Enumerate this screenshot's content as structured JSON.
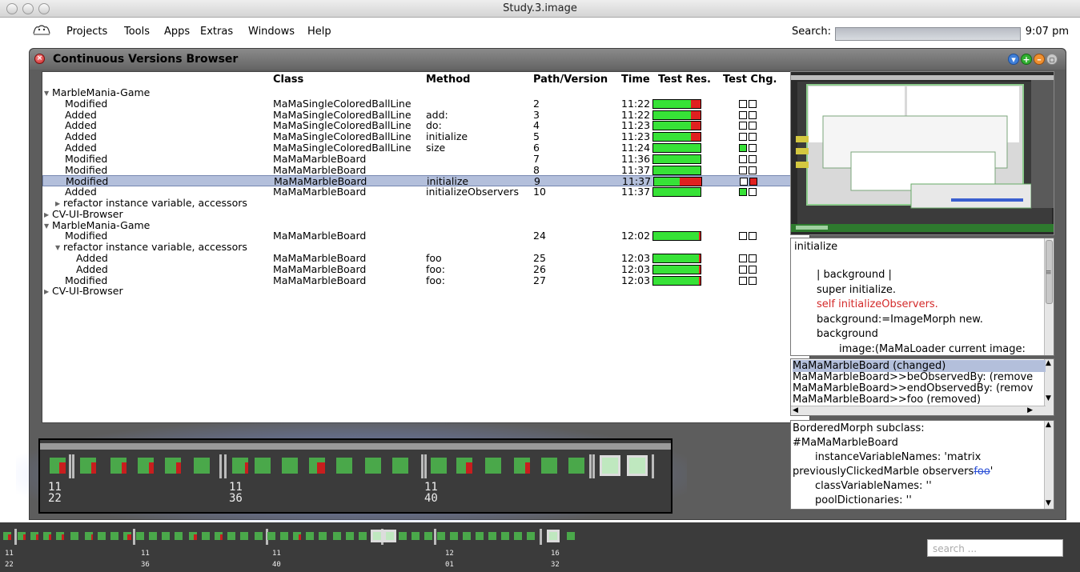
{
  "window": {
    "title": "Study.3.image"
  },
  "menubar": {
    "items": [
      "Projects",
      "Tools",
      "Apps",
      "Extras",
      "Windows",
      "Help"
    ],
    "search_label": "Search:",
    "clock": "9:07 pm"
  },
  "browser": {
    "title": "Continuous Versions Browser",
    "columns": [
      "Class",
      "Method",
      "Path/Version",
      "Time",
      "Test Res.",
      "Test Chg."
    ],
    "rows": [
      {
        "kind": "group",
        "label": "MarbleMania-Game",
        "expanded": true
      },
      {
        "kind": "change",
        "label": "Modified",
        "cls": "MaMaSingleColoredBallLine",
        "method": "",
        "version": "2",
        "time": "11:22",
        "test_fail_fraction": 0.2,
        "chg": [
          "",
          ""
        ]
      },
      {
        "kind": "change",
        "label": "Added",
        "cls": "MaMaSingleColoredBallLine",
        "method": "add:",
        "version": "3",
        "time": "11:22",
        "test_fail_fraction": 0.2,
        "chg": [
          "",
          ""
        ]
      },
      {
        "kind": "change",
        "label": "Added",
        "cls": "MaMaSingleColoredBallLine",
        "method": "do:",
        "version": "4",
        "time": "11:23",
        "test_fail_fraction": 0.2,
        "chg": [
          "",
          ""
        ]
      },
      {
        "kind": "change",
        "label": "Added",
        "cls": "MaMaSingleColoredBallLine",
        "method": "initialize",
        "version": "5",
        "time": "11:23",
        "test_fail_fraction": 0.2,
        "chg": [
          "",
          ""
        ]
      },
      {
        "kind": "change",
        "label": "Added",
        "cls": "MaMaSingleColoredBallLine",
        "method": "size",
        "version": "6",
        "time": "11:24",
        "test_fail_fraction": 0,
        "chg": [
          "green",
          ""
        ]
      },
      {
        "kind": "change",
        "label": "Modified",
        "cls": "MaMaMarbleBoard",
        "method": "",
        "version": "7",
        "time": "11:36",
        "test_fail_fraction": 0,
        "chg": [
          "",
          ""
        ]
      },
      {
        "kind": "change",
        "label": "Modified",
        "cls": "MaMaMarbleBoard",
        "method": "",
        "version": "8",
        "time": "11:37",
        "test_fail_fraction": 0,
        "chg": [
          "",
          ""
        ]
      },
      {
        "kind": "change",
        "label": "Modified",
        "cls": "MaMaMarbleBoard",
        "method": "initialize",
        "version": "9",
        "time": "11:37",
        "test_fail_fraction": 0.45,
        "chg": [
          "",
          "red"
        ],
        "selected": true
      },
      {
        "kind": "change",
        "label": "Added",
        "cls": "MaMaMarbleBoard",
        "method": "initializeObservers",
        "version": "10",
        "time": "11:37",
        "test_fail_fraction": 0,
        "chg": [
          "green",
          ""
        ]
      },
      {
        "kind": "subgroup",
        "label": "refactor instance variable, accessors",
        "expanded": false
      },
      {
        "kind": "group",
        "label": "CV-UI-Browser",
        "expanded": false
      },
      {
        "kind": "group",
        "label": "MarbleMania-Game",
        "expanded": true
      },
      {
        "kind": "change",
        "label": "Modified",
        "cls": "MaMaMarbleBoard",
        "method": "",
        "version": "24",
        "time": "12:02",
        "test_fail_fraction": 0.04,
        "chg": [
          "",
          ""
        ]
      },
      {
        "kind": "subgroup",
        "label": "refactor instance variable, accessors",
        "expanded": true
      },
      {
        "kind": "change",
        "label": "Added",
        "cls": "MaMaMarbleBoard",
        "method": "foo",
        "version": "25",
        "time": "12:03",
        "test_fail_fraction": 0.04,
        "chg": [
          "",
          ""
        ],
        "indent": true
      },
      {
        "kind": "change",
        "label": "Added",
        "cls": "MaMaMarbleBoard",
        "method": "foo:",
        "version": "26",
        "time": "12:03",
        "test_fail_fraction": 0.04,
        "chg": [
          "",
          ""
        ],
        "indent": true
      },
      {
        "kind": "change",
        "label": "Modified",
        "cls": "MaMaMarbleBoard",
        "method": "foo:",
        "version": "27",
        "time": "12:03",
        "test_fail_fraction": 0.04,
        "chg": [
          "",
          ""
        ]
      },
      {
        "kind": "group",
        "label": "CV-UI-Browser",
        "expanded": false
      }
    ]
  },
  "method_source": {
    "lines": [
      {
        "text": "initialize",
        "color": "#000000",
        "indent": 0
      },
      {
        "text": "| background |",
        "color": "#000000",
        "indent": 2
      },
      {
        "text": "super initialize.",
        "color": "#000000",
        "indent": 2
      },
      {
        "text": "self initializeObservers.",
        "color": "#d42a2a",
        "indent": 2
      },
      {
        "text": "background:=ImageMorph new.",
        "color": "#000000",
        "indent": 2
      },
      {
        "text": "background",
        "color": "#000000",
        "indent": 2
      },
      {
        "text": "image:(MaMaLoader current image:",
        "color": "#000000",
        "indent": 4
      }
    ]
  },
  "changes_list": {
    "items": [
      "MaMaMarbleBoard (changed)",
      "MaMaMarbleBoard>>beObservedBy: (remove",
      "MaMaMarbleBoard>>endObservedBy: (remov",
      "MaMaMarbleBoard>>foo (removed)"
    ],
    "selected_index": 0
  },
  "class_definition": {
    "lines": [
      {
        "text": "BorderedMorph subclass:",
        "indent": 0
      },
      {
        "text": "#MaMaMarbleBoard",
        "indent": 0
      },
      {
        "text": "instanceVariableNames: 'matrix",
        "indent": 2
      },
      {
        "text": "previouslyClickedMarble observers",
        "indent": 0,
        "struck": "foo",
        "tail": "'"
      },
      {
        "text": "classVariableNames: ''",
        "indent": 2
      },
      {
        "text": "poolDictionaries: ''",
        "indent": 2
      }
    ]
  },
  "timeline_zoom": {
    "labels": [
      {
        "line1": "11",
        "line2": "22"
      },
      {
        "line1": "11",
        "line2": "36"
      },
      {
        "line1": "11",
        "line2": "40"
      }
    ]
  },
  "timeline_bottom": {
    "labels": [
      {
        "line1": "11",
        "line2": "22"
      },
      {
        "line1": "11",
        "line2": "36"
      },
      {
        "line1": "11",
        "line2": "40"
      },
      {
        "line1": "12",
        "line2": "01"
      },
      {
        "line1": "16",
        "line2": "32"
      }
    ],
    "search_placeholder": "search ..."
  },
  "colors": {
    "test_pass": "#37e237",
    "test_fail": "#e02020",
    "selection": "#b3bfdb",
    "timeline_bg": "#3b3b3b"
  }
}
